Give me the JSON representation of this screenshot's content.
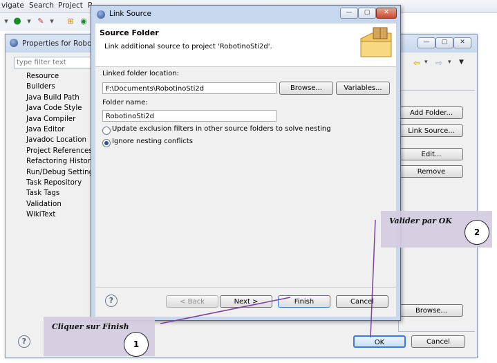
{
  "menubar": {
    "items": [
      "vigate",
      "Search",
      "Project",
      "R"
    ]
  },
  "properties": {
    "title": "Properties for Robotin",
    "filter_placeholder": "type filter text",
    "tree": [
      "Resource",
      "Builders",
      "Java Build Path",
      "Java Code Style",
      "Java Compiler",
      "Java Editor",
      "Javadoc Location",
      "Project References",
      "Refactoring History",
      "Run/Debug Settings",
      "Task Repository",
      "Task Tags",
      "Validation",
      "WikiText"
    ],
    "buttons": {
      "add_folder": "Add Folder...",
      "link_source": "Link Source...",
      "edit": "Edit...",
      "remove": "Remove",
      "browse": "Browse...",
      "ok": "OK",
      "cancel": "Cancel"
    }
  },
  "dialog": {
    "title": "Link Source",
    "header_title": "Source Folder",
    "header_desc": "Link additional source to project 'RobotinoSti2d'.",
    "linked_label": "Linked folder location:",
    "linked_value": "F:\\Documents\\RobotinoSti2d",
    "browse": "Browse...",
    "variables": "Variables...",
    "folder_label": "Folder name:",
    "folder_value": "RobotinoSti2d",
    "radio_update": "Update exclusion filters in other source folders to solve nesting",
    "radio_ignore": "Ignore nesting conflicts",
    "back": "< Back",
    "next": "Next >",
    "finish": "Finish",
    "cancel": "Cancel"
  },
  "annotations": {
    "finish_note": "Cliquer sur Finish",
    "finish_num": "1",
    "ok_note": "Valider par OK",
    "ok_num": "2"
  },
  "colors": {
    "annotation_bg": "#d4cce0",
    "arrow": "#7a3fa0",
    "focus": "#3d7bd9"
  }
}
